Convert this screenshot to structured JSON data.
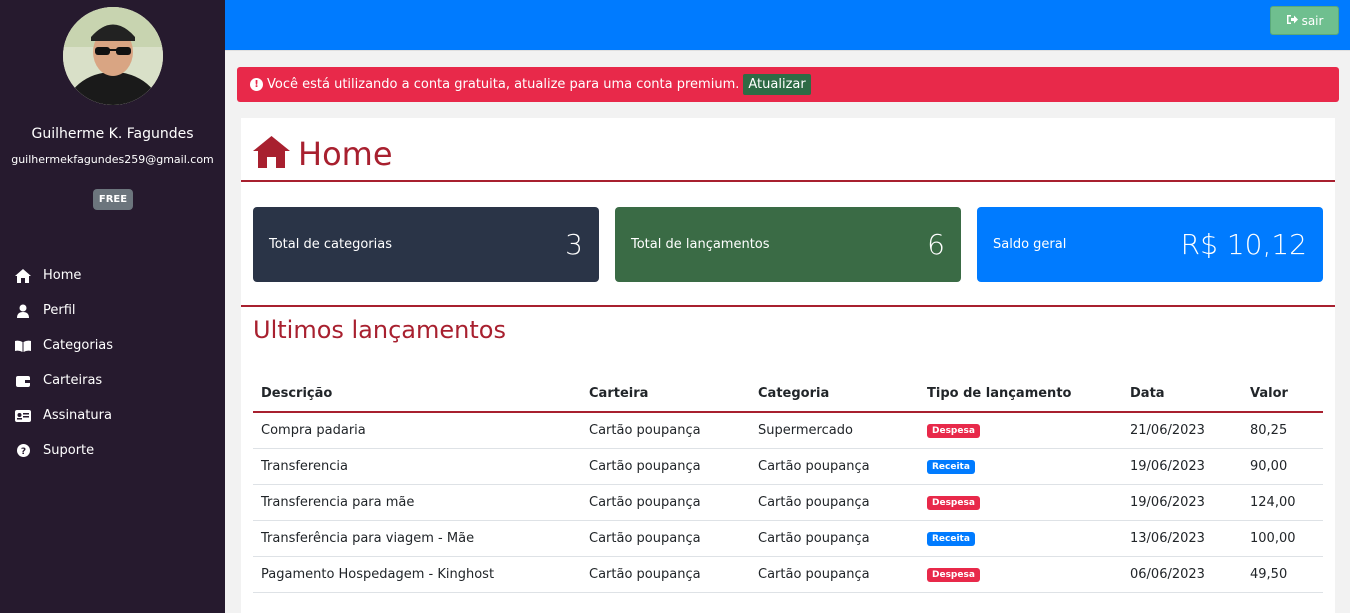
{
  "user": {
    "name": "Guilherme K. Fagundes",
    "email": "guilhermekfagundes259@gmail.com",
    "plan": "FREE"
  },
  "nav": [
    {
      "label": "Home",
      "icon": "home-icon"
    },
    {
      "label": "Perfil",
      "icon": "user-icon"
    },
    {
      "label": "Categorias",
      "icon": "book-icon"
    },
    {
      "label": "Carteiras",
      "icon": "wallet-icon"
    },
    {
      "label": "Assinatura",
      "icon": "id-card-icon"
    },
    {
      "label": "Suporte",
      "icon": "question-circle-icon"
    }
  ],
  "topbar": {
    "logout_label": "sair"
  },
  "alert": {
    "message": "Você está utilizando a conta gratuita, atualize para uma conta premium.",
    "button_label": "Atualizar"
  },
  "page": {
    "title": "Home"
  },
  "cards": [
    {
      "label": "Total de categorias",
      "value": "3",
      "color": "#2a3447"
    },
    {
      "label": "Total de lançamentos",
      "value": "6",
      "color": "#3a6b45"
    },
    {
      "label": "Saldo geral",
      "value": "R$ 10,12",
      "color": "#007bff"
    }
  ],
  "recent": {
    "title": "Ultimos lançamentos",
    "columns": [
      "Descrição",
      "Carteira",
      "Categoria",
      "Tipo de lançamento",
      "Data",
      "Valor"
    ],
    "rows": [
      {
        "descricao": "Compra padaria",
        "carteira": "Cartão poupança",
        "categoria": "Supermercado",
        "tipo": "Despesa",
        "data": "21/06/2023",
        "valor": "80,25"
      },
      {
        "descricao": "Transferencia",
        "carteira": "Cartão poupança",
        "categoria": "Cartão poupança",
        "tipo": "Receita",
        "data": "19/06/2023",
        "valor": "90,00"
      },
      {
        "descricao": "Transferencia para mãe",
        "carteira": "Cartão poupança",
        "categoria": "Cartão poupança",
        "tipo": "Despesa",
        "data": "19/06/2023",
        "valor": "124,00"
      },
      {
        "descricao": "Transferência para viagem - Mãe",
        "carteira": "Cartão poupança",
        "categoria": "Cartão poupança",
        "tipo": "Receita",
        "data": "13/06/2023",
        "valor": "100,00"
      },
      {
        "descricao": "Pagamento Hospedagem - Kinghost",
        "carteira": "Cartão poupança",
        "categoria": "Cartão poupança",
        "tipo": "Despesa",
        "data": "06/06/2023",
        "valor": "49,50"
      }
    ]
  },
  "colors": {
    "accent_red": "#a8202f",
    "despesa": "#e8294a",
    "receita": "#007bff",
    "sidebar": "#261a2e",
    "topbar": "#007bff"
  }
}
